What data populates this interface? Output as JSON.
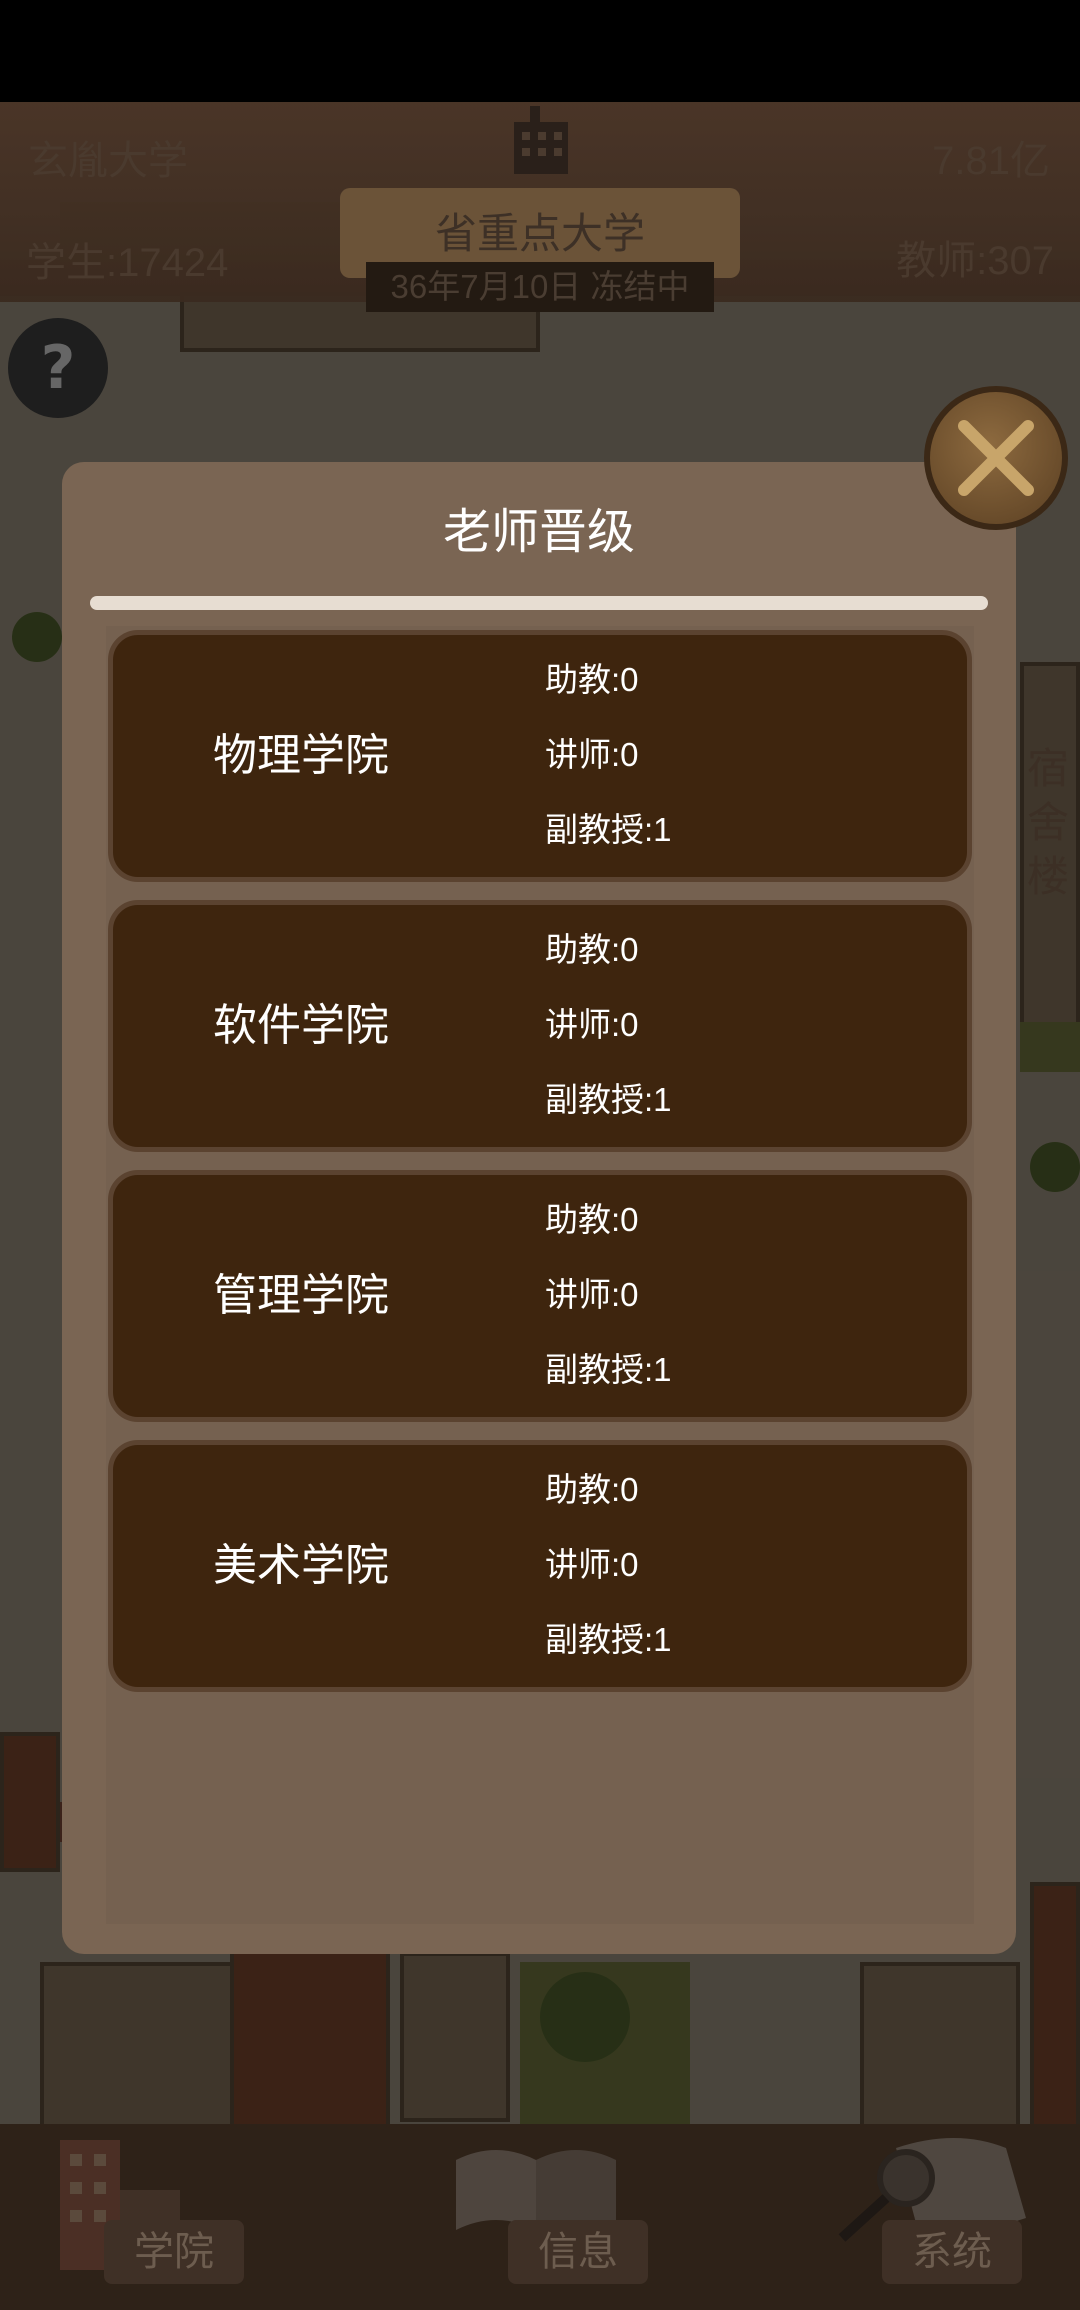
{
  "hud": {
    "university_name": "玄胤大学",
    "money": "7.81亿",
    "rank": "省重点大学",
    "date_status": "36年7月10日 冻结中",
    "students": "学生:17424",
    "teachers": "教师:307",
    "help_icon": "question-icon",
    "side_building_label": "宿舍楼"
  },
  "modal": {
    "title": "老师晋级",
    "close_icon": "close-x-icon",
    "colleges": [
      {
        "name": "物理学院",
        "assistant": "助教:0",
        "lecturer": "讲师:0",
        "assoc_prof": "副教授:1"
      },
      {
        "name": "软件学院",
        "assistant": "助教:0",
        "lecturer": "讲师:0",
        "assoc_prof": "副教授:1"
      },
      {
        "name": "管理学院",
        "assistant": "助教:0",
        "lecturer": "讲师:0",
        "assoc_prof": "副教授:1"
      },
      {
        "name": "美术学院",
        "assistant": "助教:0",
        "lecturer": "讲师:0",
        "assoc_prof": "副教授:1"
      }
    ]
  },
  "bottom_nav": {
    "college_label": "学院",
    "info_label": "信息",
    "system_label": "系统"
  },
  "colors": {
    "modal_bg": "#7a6553",
    "card_bg": "#3e250e",
    "divider": "#e7ddd2"
  }
}
